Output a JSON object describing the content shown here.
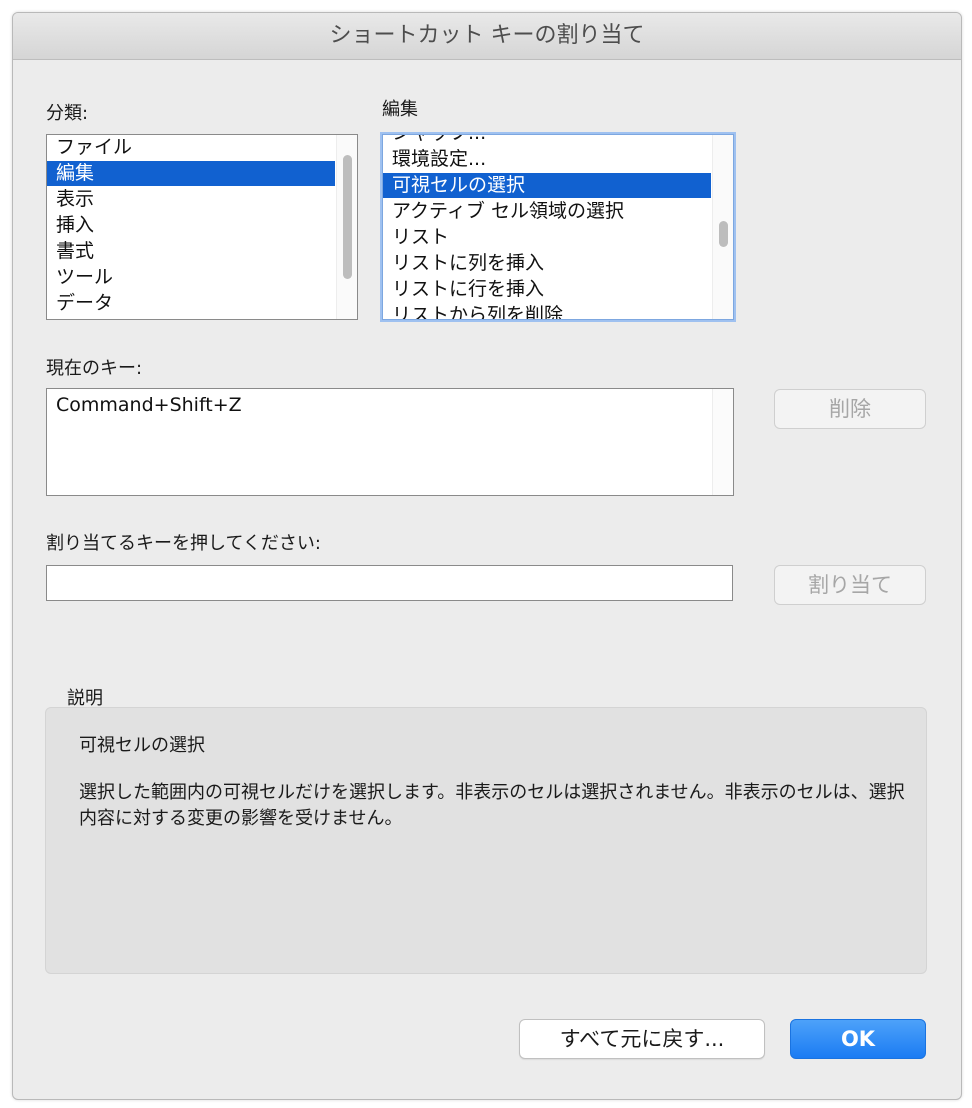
{
  "window": {
    "title": "ショートカット キーの割り当て"
  },
  "categories": {
    "label": "分類:",
    "items": [
      "ファイル",
      "編集",
      "表示",
      "挿入",
      "書式",
      "ツール",
      "データ"
    ],
    "selected_index": 1
  },
  "commands": {
    "label": "編集",
    "items": [
      "シャッフ...",
      "環境設定...",
      "可視セルの選択",
      "アクティブ セル領域の選択",
      "リスト",
      "リストに列を挿入",
      "リストに行を挿入",
      "リストから列を削除"
    ],
    "selected_index": 2
  },
  "current_keys": {
    "label": "現在のキー:",
    "values": [
      "Command+Shift+Z"
    ],
    "delete_button": "削除"
  },
  "assign": {
    "label": "割り当てるキーを押してください:",
    "value": "",
    "assign_button": "割り当て"
  },
  "description": {
    "label": "説明",
    "title": "可視セルの選択",
    "body": "選択した範囲内の可視セルだけを選択します。非表示のセルは選択されません。非表示のセルは、選択内容に対する変更の影響を受けません。"
  },
  "footer": {
    "reset_button": "すべて元に戻す...",
    "ok_button": "OK"
  },
  "colors": {
    "selection": "#1161d0",
    "primary_button": "#1b7cf3",
    "window_bg": "#ececec"
  }
}
